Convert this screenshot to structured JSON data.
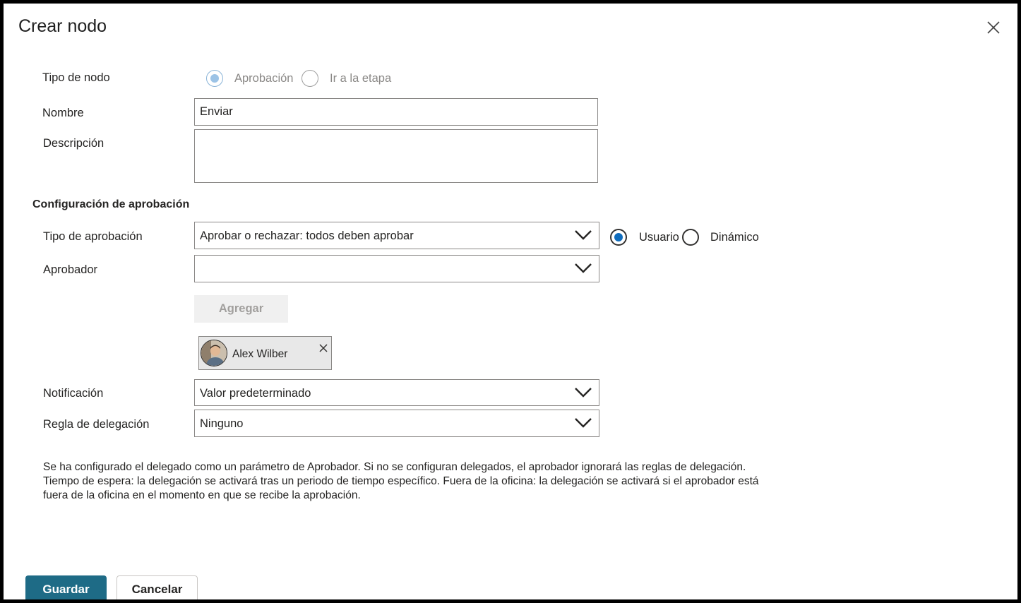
{
  "dialog": {
    "title": "Crear nodo",
    "close_icon": "close-icon"
  },
  "node_type": {
    "label": "Tipo de nodo",
    "options": [
      {
        "label": "Aprobación",
        "selected": true
      },
      {
        "label": "Ir a la etapa",
        "selected": false
      }
    ]
  },
  "name": {
    "label": "Nombre",
    "value": "Enviar"
  },
  "description": {
    "label": "Descripción",
    "value": ""
  },
  "approval_config": {
    "title": "Configuración de aprobación",
    "approval_type": {
      "label": "Tipo de aprobación",
      "selected": "Aprobar o rechazar: todos deben aprobar"
    },
    "approver_mode": {
      "options": [
        {
          "label": "Usuario",
          "selected": true
        },
        {
          "label": "Dinámico",
          "selected": false
        }
      ]
    },
    "approver": {
      "label": "Aprobador",
      "selected": ""
    },
    "add_button": "Agregar",
    "approvers": [
      {
        "name": "Alex Wilber",
        "icon": "remove-icon"
      }
    ],
    "notification": {
      "label": "Notificación",
      "selected": "Valor predeterminado"
    },
    "delegation_rule": {
      "label": "Regla de delegación",
      "selected": "Ninguno"
    }
  },
  "info_text": [
    "Se ha configurado el delegado como un parámetro de Aprobador. Si no se configuran delegados, el aprobador ignorará las reglas de delegación.",
    "Tiempo de espera: la delegación se activará tras un periodo de tiempo específico. Fuera de la oficina: la delegación se activará si el aprobador está",
    "fuera de la oficina en el momento en que se recibe la aprobación."
  ],
  "footer": {
    "save": "Guardar",
    "cancel": "Cancelar"
  },
  "colors": {
    "primary": "#1e6b86",
    "radio_accent": "#0f6cbd"
  }
}
